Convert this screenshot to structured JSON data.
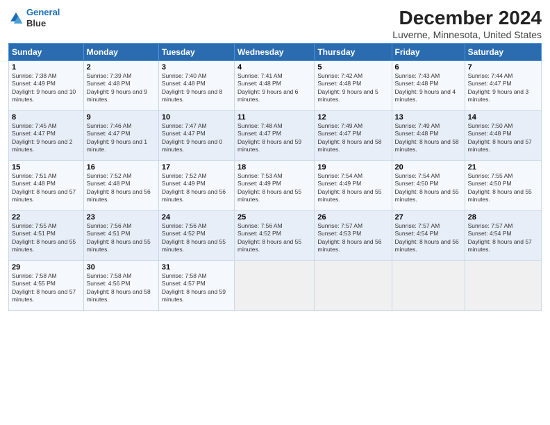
{
  "header": {
    "logo_line1": "General",
    "logo_line2": "Blue",
    "title": "December 2024",
    "subtitle": "Luverne, Minnesota, United States"
  },
  "days_of_week": [
    "Sunday",
    "Monday",
    "Tuesday",
    "Wednesday",
    "Thursday",
    "Friday",
    "Saturday"
  ],
  "weeks": [
    [
      {
        "day": 1,
        "sunrise": "7:38 AM",
        "sunset": "4:49 PM",
        "daylight": "9 hours and 10 minutes."
      },
      {
        "day": 2,
        "sunrise": "7:39 AM",
        "sunset": "4:48 PM",
        "daylight": "9 hours and 9 minutes."
      },
      {
        "day": 3,
        "sunrise": "7:40 AM",
        "sunset": "4:48 PM",
        "daylight": "9 hours and 8 minutes."
      },
      {
        "day": 4,
        "sunrise": "7:41 AM",
        "sunset": "4:48 PM",
        "daylight": "9 hours and 6 minutes."
      },
      {
        "day": 5,
        "sunrise": "7:42 AM",
        "sunset": "4:48 PM",
        "daylight": "9 hours and 5 minutes."
      },
      {
        "day": 6,
        "sunrise": "7:43 AM",
        "sunset": "4:48 PM",
        "daylight": "9 hours and 4 minutes."
      },
      {
        "day": 7,
        "sunrise": "7:44 AM",
        "sunset": "4:47 PM",
        "daylight": "9 hours and 3 minutes."
      }
    ],
    [
      {
        "day": 8,
        "sunrise": "7:45 AM",
        "sunset": "4:47 PM",
        "daylight": "9 hours and 2 minutes."
      },
      {
        "day": 9,
        "sunrise": "7:46 AM",
        "sunset": "4:47 PM",
        "daylight": "9 hours and 1 minute."
      },
      {
        "day": 10,
        "sunrise": "7:47 AM",
        "sunset": "4:47 PM",
        "daylight": "9 hours and 0 minutes."
      },
      {
        "day": 11,
        "sunrise": "7:48 AM",
        "sunset": "4:47 PM",
        "daylight": "8 hours and 59 minutes."
      },
      {
        "day": 12,
        "sunrise": "7:49 AM",
        "sunset": "4:47 PM",
        "daylight": "8 hours and 58 minutes."
      },
      {
        "day": 13,
        "sunrise": "7:49 AM",
        "sunset": "4:48 PM",
        "daylight": "8 hours and 58 minutes."
      },
      {
        "day": 14,
        "sunrise": "7:50 AM",
        "sunset": "4:48 PM",
        "daylight": "8 hours and 57 minutes."
      }
    ],
    [
      {
        "day": 15,
        "sunrise": "7:51 AM",
        "sunset": "4:48 PM",
        "daylight": "8 hours and 57 minutes."
      },
      {
        "day": 16,
        "sunrise": "7:52 AM",
        "sunset": "4:48 PM",
        "daylight": "8 hours and 56 minutes."
      },
      {
        "day": 17,
        "sunrise": "7:52 AM",
        "sunset": "4:49 PM",
        "daylight": "8 hours and 56 minutes."
      },
      {
        "day": 18,
        "sunrise": "7:53 AM",
        "sunset": "4:49 PM",
        "daylight": "8 hours and 55 minutes."
      },
      {
        "day": 19,
        "sunrise": "7:54 AM",
        "sunset": "4:49 PM",
        "daylight": "8 hours and 55 minutes."
      },
      {
        "day": 20,
        "sunrise": "7:54 AM",
        "sunset": "4:50 PM",
        "daylight": "8 hours and 55 minutes."
      },
      {
        "day": 21,
        "sunrise": "7:55 AM",
        "sunset": "4:50 PM",
        "daylight": "8 hours and 55 minutes."
      }
    ],
    [
      {
        "day": 22,
        "sunrise": "7:55 AM",
        "sunset": "4:51 PM",
        "daylight": "8 hours and 55 minutes."
      },
      {
        "day": 23,
        "sunrise": "7:56 AM",
        "sunset": "4:51 PM",
        "daylight": "8 hours and 55 minutes."
      },
      {
        "day": 24,
        "sunrise": "7:56 AM",
        "sunset": "4:52 PM",
        "daylight": "8 hours and 55 minutes."
      },
      {
        "day": 25,
        "sunrise": "7:56 AM",
        "sunset": "4:52 PM",
        "daylight": "8 hours and 55 minutes."
      },
      {
        "day": 26,
        "sunrise": "7:57 AM",
        "sunset": "4:53 PM",
        "daylight": "8 hours and 56 minutes."
      },
      {
        "day": 27,
        "sunrise": "7:57 AM",
        "sunset": "4:54 PM",
        "daylight": "8 hours and 56 minutes."
      },
      {
        "day": 28,
        "sunrise": "7:57 AM",
        "sunset": "4:54 PM",
        "daylight": "8 hours and 57 minutes."
      }
    ],
    [
      {
        "day": 29,
        "sunrise": "7:58 AM",
        "sunset": "4:55 PM",
        "daylight": "8 hours and 57 minutes."
      },
      {
        "day": 30,
        "sunrise": "7:58 AM",
        "sunset": "4:56 PM",
        "daylight": "8 hours and 58 minutes."
      },
      {
        "day": 31,
        "sunrise": "7:58 AM",
        "sunset": "4:57 PM",
        "daylight": "8 hours and 59 minutes."
      },
      null,
      null,
      null,
      null
    ]
  ],
  "labels": {
    "sunrise": "Sunrise:",
    "sunset": "Sunset:",
    "daylight": "Daylight:"
  }
}
